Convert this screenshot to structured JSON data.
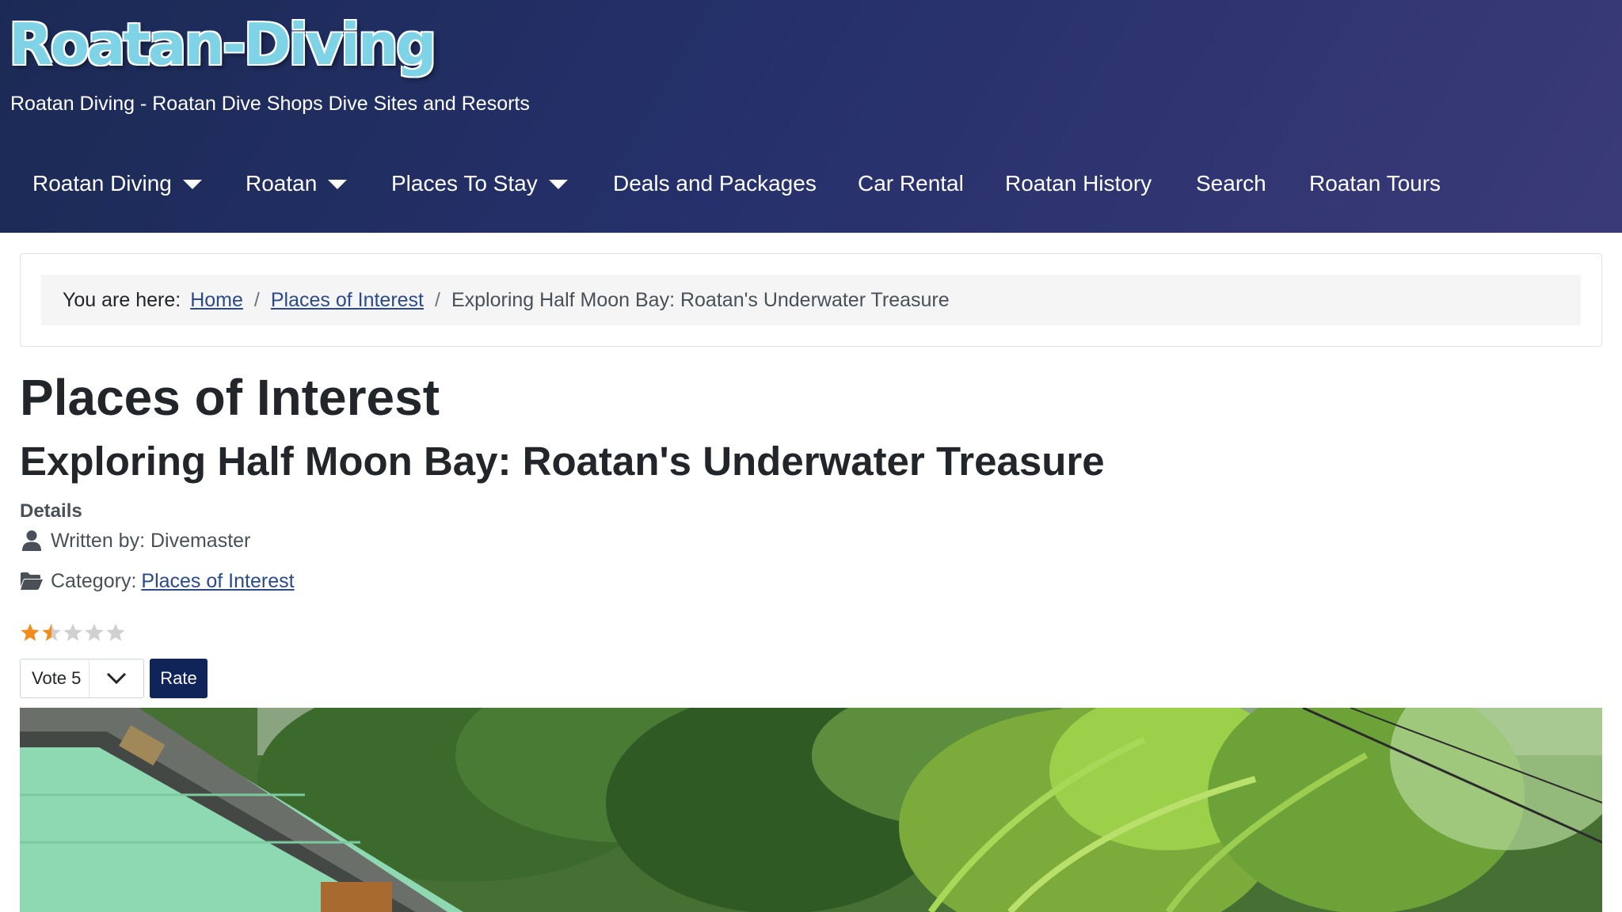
{
  "site": {
    "logo_text": "Roatan-Diving",
    "tagline": "Roatan Diving - Roatan Dive Shops Dive Sites and Resorts"
  },
  "nav": {
    "items": [
      {
        "label": "Roatan Diving",
        "has_dropdown": true
      },
      {
        "label": "Roatan",
        "has_dropdown": true
      },
      {
        "label": "Places To Stay",
        "has_dropdown": true
      },
      {
        "label": "Deals and Packages",
        "has_dropdown": false
      },
      {
        "label": "Car Rental",
        "has_dropdown": false
      },
      {
        "label": "Roatan History",
        "has_dropdown": false
      },
      {
        "label": "Search",
        "has_dropdown": false
      },
      {
        "label": "Roatan Tours",
        "has_dropdown": false
      }
    ]
  },
  "breadcrumb": {
    "label": "You are here:",
    "items": [
      "Home",
      "Places of Interest"
    ],
    "separator": "/",
    "current": "Exploring Half Moon Bay: Roatan's Underwater Treasure"
  },
  "page": {
    "category_title": "Places of Interest",
    "article_title": "Exploring Half Moon Bay: Roatan's Underwater Treasure"
  },
  "details": {
    "heading": "Details",
    "written_by": "Written by: Divemaster",
    "category_label": "Category:",
    "category_link": "Places of Interest"
  },
  "rating": {
    "value": 1.5,
    "max": 5,
    "vote_selected": "Vote 5",
    "rate_label": "Rate"
  },
  "colors": {
    "header_bg": "#25306a",
    "link": "#2b4a8a",
    "rate_button": "#10245a",
    "star_filled": "#f28c1e",
    "star_empty": "#d0d0d0"
  }
}
